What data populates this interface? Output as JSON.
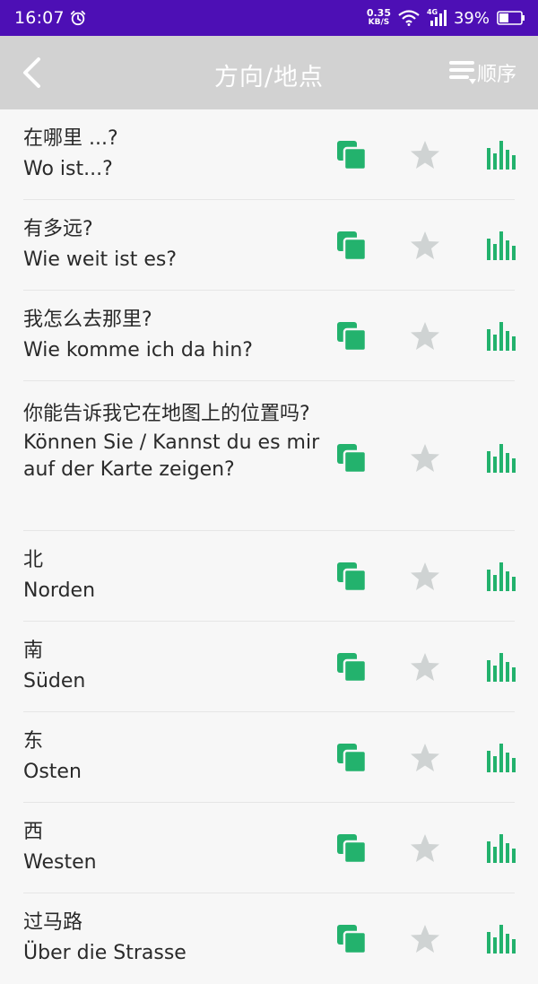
{
  "status_bar": {
    "time": "16:07",
    "net_speed_value": "0.35",
    "net_speed_unit": "KB/S",
    "network": "4G",
    "battery": "39%"
  },
  "app_bar": {
    "title": "方向/地点",
    "sort_label": "顺序"
  },
  "colors": {
    "status_bar": "#4d0fb5",
    "app_bar": "#d2d2d2",
    "accent_green": "#23b26d",
    "star_grey": "#cfd3d3"
  },
  "phrases": [
    {
      "chinese": "在哪里 ...?",
      "german": "Wo ist...?"
    },
    {
      "chinese": "有多远?",
      "german": "Wie weit ist es?"
    },
    {
      "chinese": "我怎么去那里?",
      "german": "Wie komme ich da hin?"
    },
    {
      "chinese": "你能告诉我它在地图上的位置吗?",
      "german": "Können Sie / Kannst du es mir auf der Karte zeigen?"
    },
    {
      "chinese": "北",
      "german": "Norden"
    },
    {
      "chinese": "南",
      "german": "Süden"
    },
    {
      "chinese": "东",
      "german": "Osten"
    },
    {
      "chinese": "西",
      "german": "Westen"
    },
    {
      "chinese": "过马路",
      "german": "Über die Strasse"
    }
  ]
}
